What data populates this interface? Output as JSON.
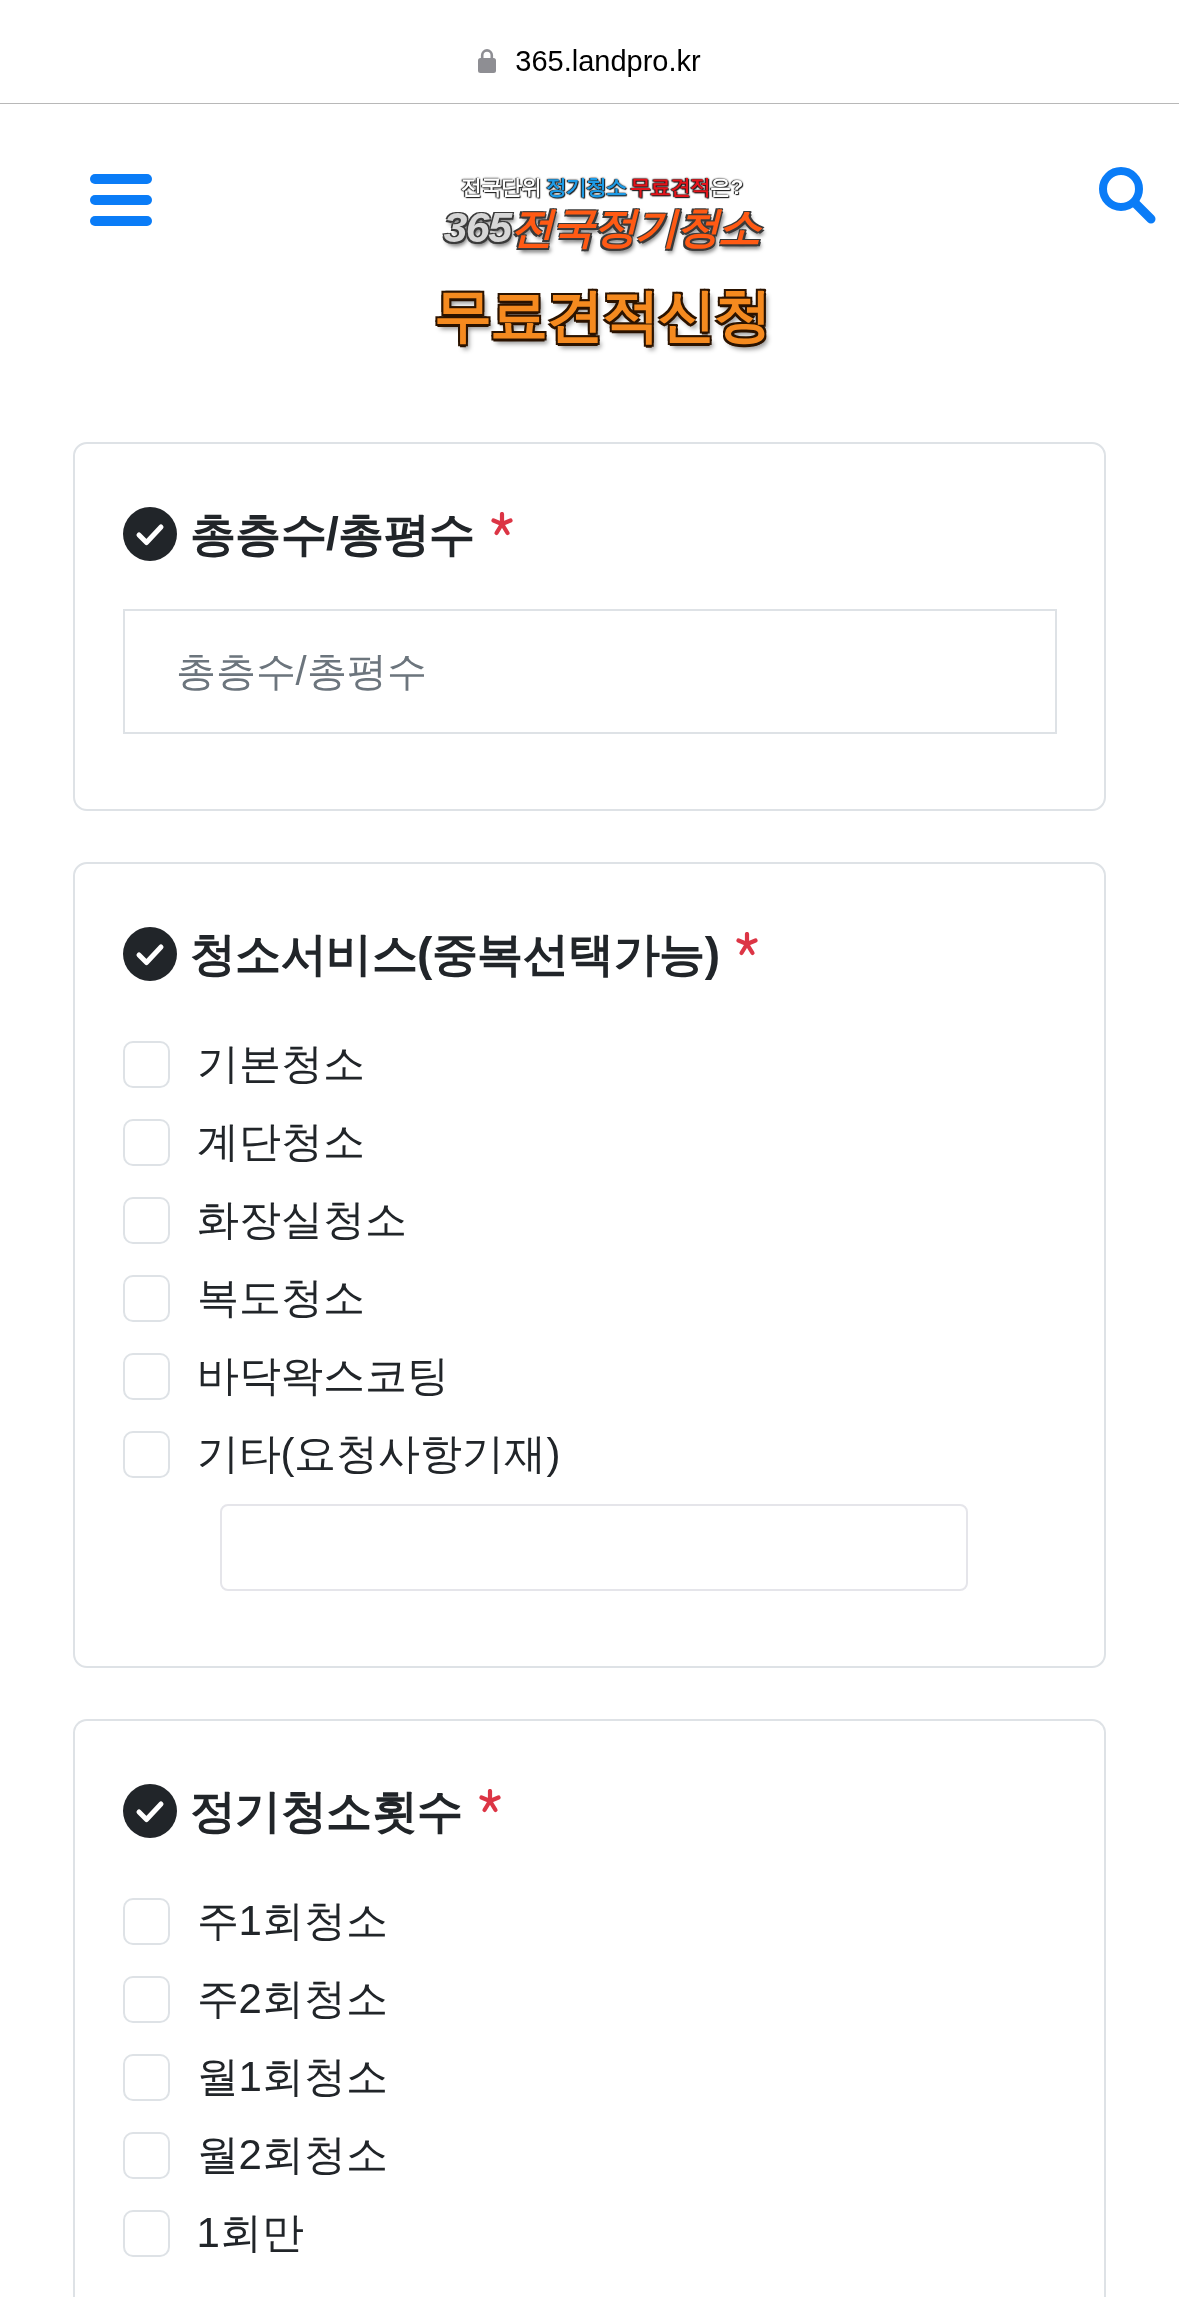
{
  "browser_bar": {
    "secure": true,
    "url": "365.landpro.kr"
  },
  "header": {
    "logo": {
      "tagline": [
        {
          "text": "전국단위",
          "color": "#ffffff"
        },
        {
          "text": " 정기청소",
          "color": "#1e9be6"
        },
        {
          "text": " 무료견적",
          "color": "#e3141b"
        },
        {
          "text": "은?",
          "color": "#ffffff"
        }
      ],
      "wordmark": [
        {
          "text": "365",
          "color": "#d6d6d6"
        },
        {
          "text": "전국정기청소",
          "color": "#ff5a14"
        }
      ]
    },
    "page_title": "무료견적신청"
  },
  "sections": [
    {
      "kind": "text",
      "title": "총층수/총평수",
      "required": true,
      "placeholder": "총층수/총평수"
    },
    {
      "kind": "checkboxes",
      "title": "청소서비스(중복선택가능)",
      "required": true,
      "options": [
        {
          "label": "기본청소",
          "checked": false,
          "kind": "plain"
        },
        {
          "label": "계단청소",
          "checked": false,
          "kind": "plain"
        },
        {
          "label": "화장실청소",
          "checked": false,
          "kind": "plain"
        },
        {
          "label": "복도청소",
          "checked": false,
          "kind": "plain"
        },
        {
          "label": "바닥왁스코팅",
          "checked": false,
          "kind": "plain"
        },
        {
          "label": "기타(요청사항기재)",
          "checked": false,
          "kind": "with_input"
        }
      ]
    },
    {
      "kind": "checkboxes",
      "title": "정기청소횟수",
      "required": true,
      "options": [
        {
          "label": "주1회청소",
          "checked": false,
          "kind": "plain"
        },
        {
          "label": "주2회청소",
          "checked": false,
          "kind": "plain"
        },
        {
          "label": "월1회청소",
          "checked": false,
          "kind": "plain"
        },
        {
          "label": "월2회청소",
          "checked": false,
          "kind": "plain"
        },
        {
          "label": "1회만",
          "checked": false,
          "kind": "plain"
        }
      ]
    }
  ]
}
